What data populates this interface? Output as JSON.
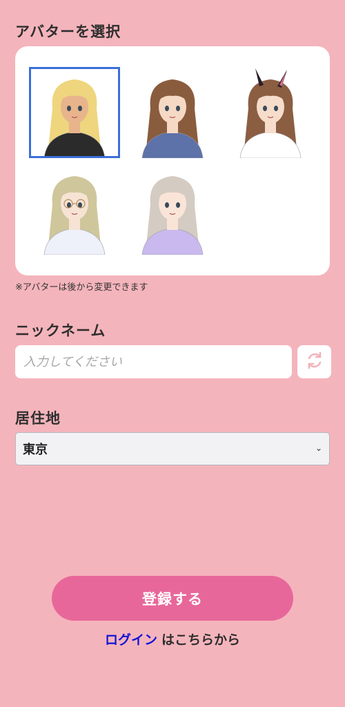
{
  "avatar_section": {
    "title": "アバターを選択",
    "note": "※アバターは後から変更できます",
    "avatars": [
      {
        "name": "blonde-long-hair-avatar",
        "selected": true,
        "hair": "#efd57e",
        "skin": "#e8b48c",
        "outfit": "#2b2b2b"
      },
      {
        "name": "brown-long-hair-avatar",
        "selected": false,
        "hair": "#8a5c3e",
        "skin": "#f5d9c5",
        "outfit": "#5d72a8"
      },
      {
        "name": "bunny-ears-avatar",
        "selected": false,
        "hair": "#8b5e42",
        "skin": "#f6dccb",
        "outfit": "#ffffff"
      },
      {
        "name": "glasses-ashblonde-avatar",
        "selected": false,
        "hair": "#cfc79b",
        "skin": "#f7e3d4",
        "outfit": "#eef0fa"
      },
      {
        "name": "silver-hair-maid-avatar",
        "selected": false,
        "hair": "#d4cbc2",
        "skin": "#fae4d8",
        "outfit": "#c9b9ee"
      }
    ]
  },
  "nickname": {
    "title": "ニックネーム",
    "placeholder": "入力してください",
    "value": "",
    "refresh_icon": "refresh-icon"
  },
  "residence": {
    "title": "居住地",
    "selected": "東京"
  },
  "actions": {
    "register_label": "登録する",
    "login_link": "ログイン",
    "login_suffix": "はこちらから"
  },
  "colors": {
    "background": "#f4b4bc",
    "accent_button": "#e8679a",
    "selection_border": "#3a6fd8",
    "login_link": "#1414d6"
  }
}
